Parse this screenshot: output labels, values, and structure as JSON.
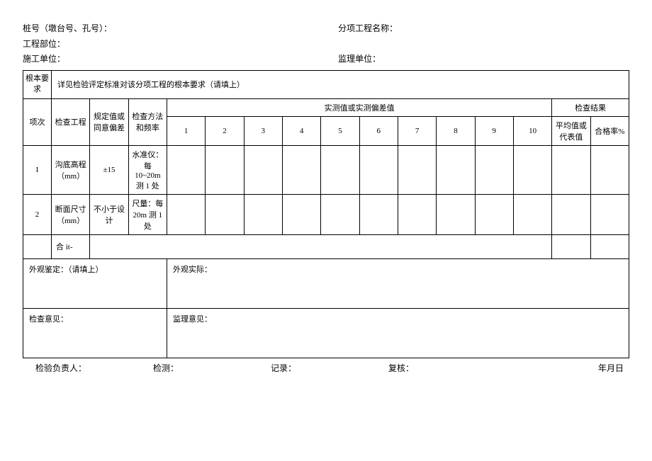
{
  "header": {
    "pile_no_label": "桩号（墩台号、孔号）：",
    "sub_project_label": "分项工程名称：",
    "part_label": "工程部位：",
    "construction_unit_label": "施工单位：",
    "supervision_unit_label": "监理单位："
  },
  "requirement": {
    "label": "根本要求",
    "text": "详见检验评定标准对该分项工程的根本要求（请填上）"
  },
  "columns": {
    "seq": "项次",
    "item": "检查工程",
    "spec": "规定值或同意偏差",
    "method": "检查方法和频率",
    "measured_group": "实测值或实测偏差值",
    "result_group": "检查结果",
    "m1": "1",
    "m2": "2",
    "m3": "3",
    "m4": "4",
    "m5": "5",
    "m6": "6",
    "m7": "7",
    "m8": "8",
    "m9": "9",
    "m10": "10",
    "avg": "平均值或代表值",
    "rate": "合格率%"
  },
  "rows": [
    {
      "seq": "I",
      "item": "沟底高程（mm）",
      "spec": "±15",
      "method": "水准仪：每 10~20m 测 1 处"
    },
    {
      "seq": "2",
      "item": "断面尺寸（mm）",
      "spec": "不小于设计",
      "method": "尺量：每 20m 测 1 处"
    }
  ],
  "summary_row": "合 it-",
  "sections": {
    "appearance_judge": "外观鉴定：（请填上）",
    "appearance_actual": "外观实际：",
    "inspect_opinion": "检查意见：",
    "supervise_opinion": "监理意见："
  },
  "footer": {
    "inspector": "检验负责人：",
    "detect": "检测：",
    "record": "记录：",
    "review": "复核：",
    "date": "年月日"
  }
}
